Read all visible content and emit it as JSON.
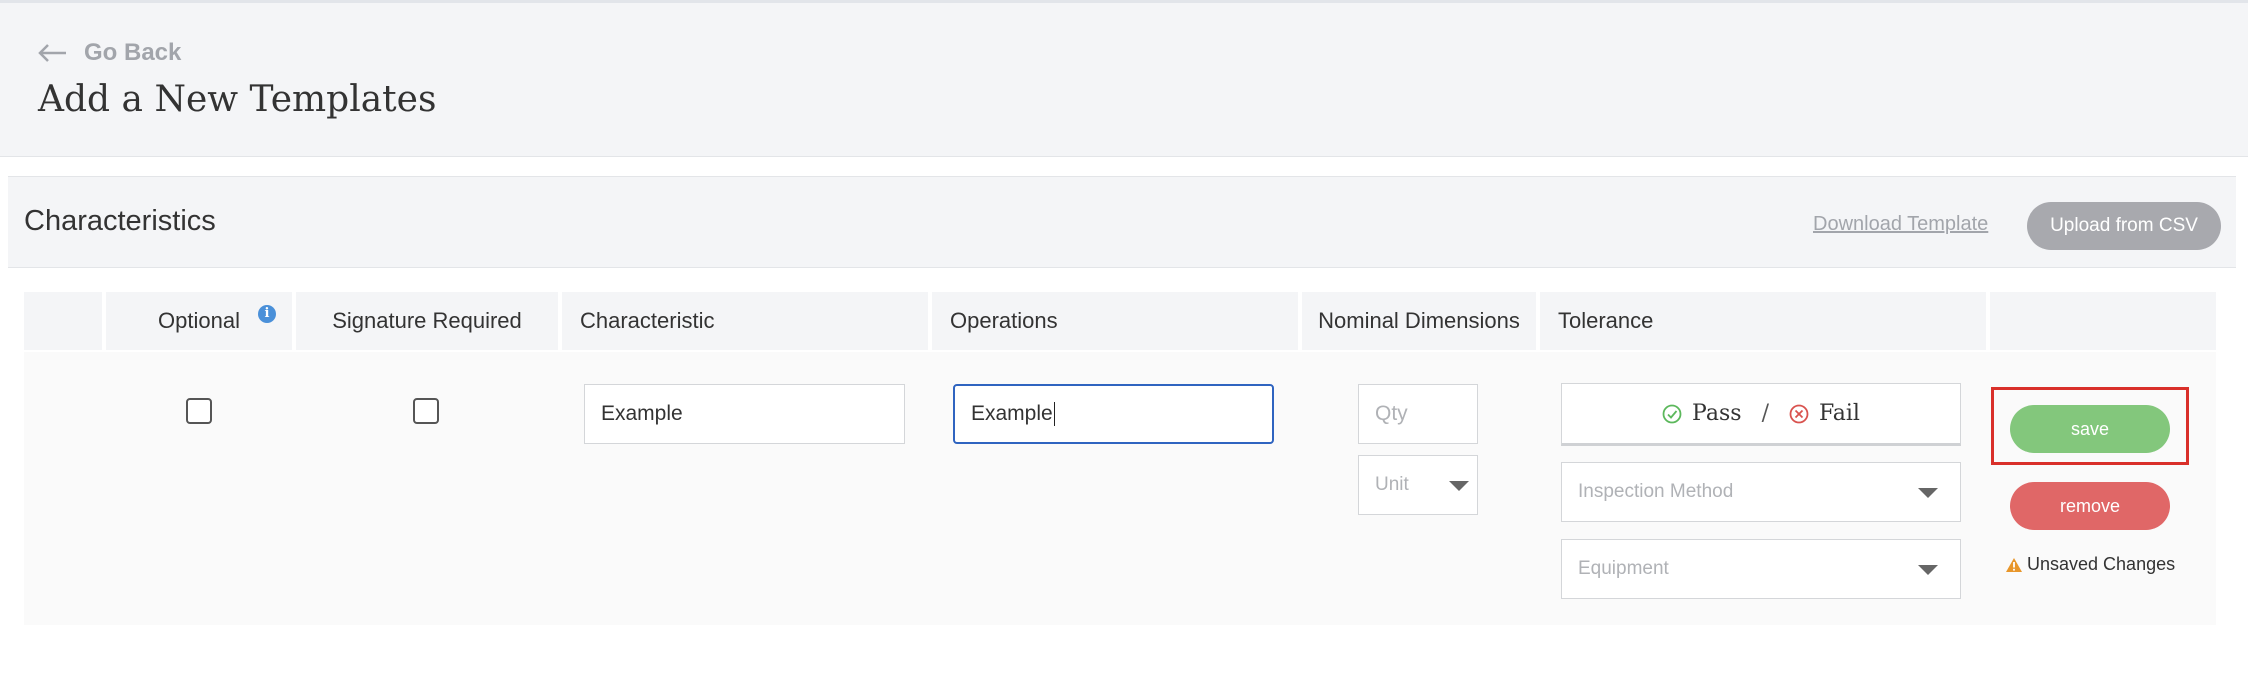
{
  "header": {
    "back_label": "Go Back",
    "title": "Add a New Templates"
  },
  "section": {
    "title": "Characteristics",
    "download_label": "Download Template",
    "upload_label": "Upload from CSV"
  },
  "columns": {
    "optional": "Optional",
    "signature": "Signature Required",
    "characteristic": "Characteristic",
    "operations": "Operations",
    "nominal": "Nominal Dimensions",
    "tolerance": "Tolerance"
  },
  "row": {
    "optional_checked": false,
    "signature_checked": false,
    "characteristic_value": "Example",
    "operations_value": "Example",
    "qty_placeholder": "Qty",
    "unit_placeholder": "Unit",
    "pass_label": "Pass",
    "separator": "/",
    "fail_label": "Fail",
    "inspection_placeholder": "Inspection Method",
    "equipment_placeholder": "Equipment",
    "save_label": "save",
    "remove_label": "remove",
    "unsaved_label": "Unsaved Changes"
  },
  "colors": {
    "save": "#83c77c",
    "remove": "#e06767",
    "focus": "#2f64c0",
    "highlight": "#d9302a",
    "info": "#4a90d9",
    "warning": "#e8962a"
  }
}
